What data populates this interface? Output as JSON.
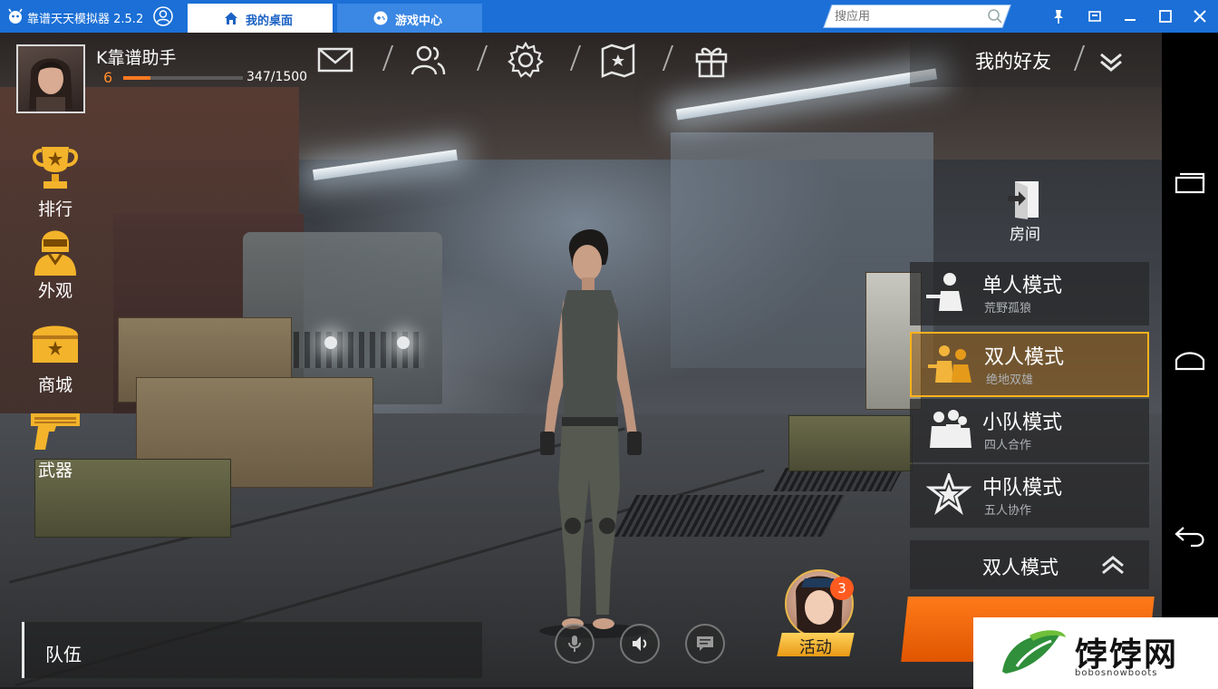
{
  "emulator": {
    "title": "靠谱天天模拟器 2.5.2",
    "tabs": [
      {
        "label": "我的桌面",
        "icon": "home-icon",
        "active": true
      },
      {
        "label": "游戏中心",
        "icon": "gamepad-icon",
        "active": false
      }
    ],
    "search": {
      "placeholder": "搜应用"
    },
    "window_controls": [
      "pin-icon",
      "restore-icon",
      "minimize-icon",
      "maximize-icon",
      "close-icon"
    ],
    "accent": "#1b6fd6"
  },
  "player": {
    "name": "K靠谱助手",
    "level": "6",
    "xp": "347/1500",
    "xp_progress": 0.23
  },
  "top_nav": {
    "icons": [
      "mail-icon",
      "friends-icon",
      "settings-icon",
      "map-icon",
      "gift-icon"
    ],
    "friends_label": "我的好友"
  },
  "side_menu": [
    {
      "label": "排行",
      "icon": "trophy-icon"
    },
    {
      "label": "外观",
      "icon": "outfit-icon"
    },
    {
      "label": "商城",
      "icon": "shop-chest-icon"
    },
    {
      "label": "武器",
      "icon": "pistol-icon"
    }
  ],
  "room": {
    "label": "房间",
    "icon": "door-exit-icon"
  },
  "modes": [
    {
      "title": "单人模式",
      "subtitle": "荒野孤狼",
      "icon": "solo-soldier-icon",
      "selected": false
    },
    {
      "title": "双人模式",
      "subtitle": "绝地双雄",
      "icon": "duo-soldiers-icon",
      "selected": true
    },
    {
      "title": "小队模式",
      "subtitle": "四人合作",
      "icon": "squad-icon",
      "selected": false
    },
    {
      "title": "中队模式",
      "subtitle": "五人协作",
      "icon": "star-badge-icon",
      "selected": false
    }
  ],
  "mode_footer": {
    "label": "双人模式",
    "icon": "chevron-up-icon"
  },
  "team": {
    "label": "队伍"
  },
  "bottom_controls": [
    "microphone-icon",
    "speaker-icon",
    "chat-icon"
  ],
  "event": {
    "label": "活动",
    "badge": "3"
  },
  "android_nav": [
    "recent-apps-icon",
    "home-icon",
    "back-icon"
  ],
  "watermark": {
    "title": "饽饽网",
    "subtitle": "bobosnowboots"
  },
  "colors": {
    "orange": "#ff7a1a",
    "gold": "#ffb21c",
    "badge": "#ff5a1f"
  }
}
